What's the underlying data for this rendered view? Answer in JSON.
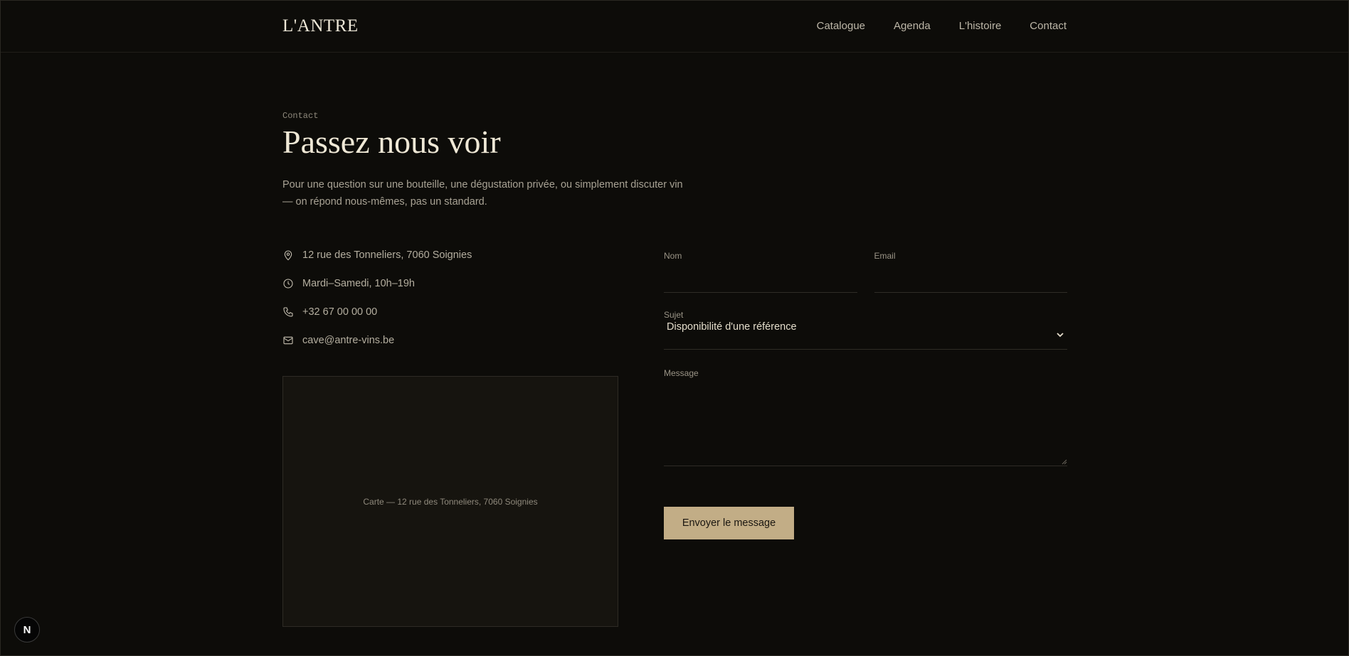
{
  "header": {
    "logo": "L'ANTRE",
    "nav": [
      "Catalogue",
      "Agenda",
      "L'histoire",
      "Contact"
    ]
  },
  "hero": {
    "eyebrow": "Contact",
    "title": "Passez nous voir",
    "intro": "Pour une question sur une bouteille, une dégustation privée, ou simplement discuter vin — on répond nous-mêmes, pas un standard."
  },
  "info": {
    "address": "12 rue des Tonneliers, 7060 Soignies",
    "hours": "Mardi–Samedi, 10h–19h",
    "phone": "+32 67 00 00 00",
    "email": "cave@antre-vins.be"
  },
  "map": {
    "label": "Carte — 12 rue des Tonneliers, 7060 Soignies"
  },
  "form": {
    "name_label": "Nom",
    "name_value": "",
    "email_label": "Email",
    "email_value": "",
    "subject_label": "Sujet",
    "subject_value": "Disponibilité d'une référence",
    "message_label": "Message",
    "message_value": "",
    "submit_label": "Envoyer le message"
  },
  "badge": {
    "letter": "N"
  },
  "colors": {
    "background": "#0d0c09",
    "accent": "#c2ad86",
    "text": "#efe8d6"
  }
}
